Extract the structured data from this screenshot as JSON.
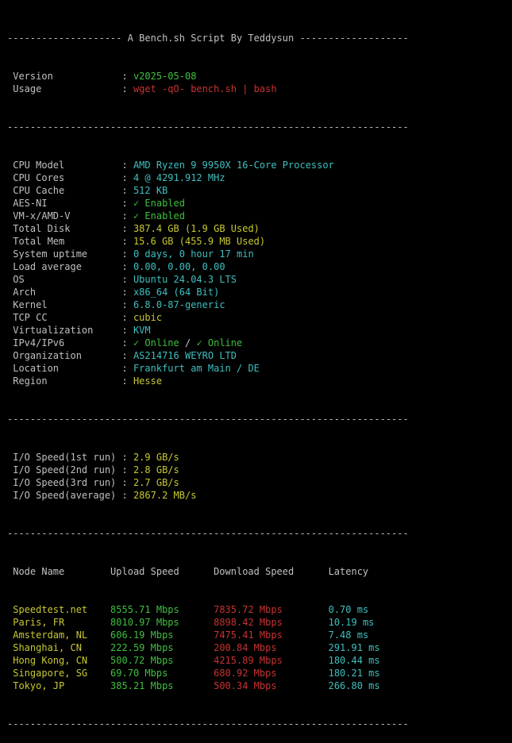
{
  "colors": {
    "background": "#000000",
    "text": "#c0c0c0",
    "green": "#3fbf3f",
    "red": "#c83232",
    "yellow": "#c8c832",
    "cyan": "#3fbfbf"
  },
  "header": "-------------------- A Bench.sh Script By Teddysun -------------------",
  "header_rows": [
    {
      "key": " Version            : ",
      "value": "v2025-05-08",
      "color": "green"
    },
    {
      "key": " Usage              : ",
      "value": "wget -qO- bench.sh | bash",
      "color": "red"
    }
  ],
  "separator": "----------------------------------------------------------------------",
  "system_rows": [
    {
      "key": " CPU Model          : ",
      "parts": [
        {
          "text": "AMD Ryzen 9 9950X 16-Core Processor",
          "color": "cyan"
        }
      ]
    },
    {
      "key": " CPU Cores          : ",
      "parts": [
        {
          "text": "4 @ 4291.912 MHz",
          "color": "cyan"
        }
      ]
    },
    {
      "key": " CPU Cache          : ",
      "parts": [
        {
          "text": "512 KB",
          "color": "cyan"
        }
      ]
    },
    {
      "key": " AES-NI             : ",
      "parts": [
        {
          "text": "✓ Enabled",
          "color": "green"
        }
      ]
    },
    {
      "key": " VM-x/AMD-V         : ",
      "parts": [
        {
          "text": "✓ Enabled",
          "color": "green"
        }
      ]
    },
    {
      "key": " Total Disk         : ",
      "parts": [
        {
          "text": "387.4 GB (1.9 GB Used)",
          "color": "yellow"
        }
      ]
    },
    {
      "key": " Total Mem          : ",
      "parts": [
        {
          "text": "15.6 GB (455.9 MB Used)",
          "color": "yellow"
        }
      ]
    },
    {
      "key": " System uptime      : ",
      "parts": [
        {
          "text": "0 days, 0 hour 17 min",
          "color": "cyan"
        }
      ]
    },
    {
      "key": " Load average       : ",
      "parts": [
        {
          "text": "0.00, 0.00, 0.00",
          "color": "cyan"
        }
      ]
    },
    {
      "key": " OS                 : ",
      "parts": [
        {
          "text": "Ubuntu 24.04.3 LTS",
          "color": "cyan"
        }
      ]
    },
    {
      "key": " Arch               : ",
      "parts": [
        {
          "text": "x86_64 (64 Bit)",
          "color": "cyan"
        }
      ]
    },
    {
      "key": " Kernel             : ",
      "parts": [
        {
          "text": "6.8.0-87-generic",
          "color": "cyan"
        }
      ]
    },
    {
      "key": " TCP CC             : ",
      "parts": [
        {
          "text": "cubic",
          "color": "yellow"
        }
      ]
    },
    {
      "key": " Virtualization     : ",
      "parts": [
        {
          "text": "KVM",
          "color": "cyan"
        }
      ]
    },
    {
      "key": " IPv4/IPv6          : ",
      "parts": [
        {
          "text": "✓ Online",
          "color": "green"
        },
        {
          "text": " / ",
          "color": "white"
        },
        {
          "text": "✓ Online",
          "color": "green"
        }
      ]
    },
    {
      "key": " Organization       : ",
      "parts": [
        {
          "text": "AS214716 WEYRO LTD",
          "color": "cyan"
        }
      ]
    },
    {
      "key": " Location           : ",
      "parts": [
        {
          "text": "Frankfurt am Main / DE",
          "color": "cyan"
        }
      ]
    },
    {
      "key": " Region             : ",
      "parts": [
        {
          "text": "Hesse",
          "color": "yellow"
        }
      ]
    }
  ],
  "io_rows": [
    {
      "key": " I/O Speed(1st run) : ",
      "value": "2.9 GB/s"
    },
    {
      "key": " I/O Speed(2nd run) : ",
      "value": "2.8 GB/s"
    },
    {
      "key": " I/O Speed(3rd run) : ",
      "value": "2.7 GB/s"
    },
    {
      "key": " I/O Speed(average) : ",
      "value": "2867.2 MB/s"
    }
  ],
  "speed_header": " Node Name        Upload Speed      Download Speed      Latency     ",
  "speed_rows": [
    {
      "node": " Speedtest.net    ",
      "upload": "8555.71 Mbps      ",
      "download": "7835.72 Mbps        ",
      "latency": "0.70 ms"
    },
    {
      "node": " Paris, FR        ",
      "upload": "8010.97 Mbps      ",
      "download": "8898.42 Mbps        ",
      "latency": "10.19 ms"
    },
    {
      "node": " Amsterdam, NL    ",
      "upload": "606.19 Mbps       ",
      "download": "7475.41 Mbps        ",
      "latency": "7.48 ms"
    },
    {
      "node": " Shanghai, CN     ",
      "upload": "222.59 Mbps       ",
      "download": "200.84 Mbps         ",
      "latency": "291.91 ms"
    },
    {
      "node": " Hong Kong, CN    ",
      "upload": "500.72 Mbps       ",
      "download": "4215.89 Mbps        ",
      "latency": "180.44 ms"
    },
    {
      "node": " Singapore, SG    ",
      "upload": "69.70 Mbps        ",
      "download": "680.92 Mbps         ",
      "latency": "180.21 ms"
    },
    {
      "node": " Tokyo, JP        ",
      "upload": "385.21 Mbps       ",
      "download": "500.34 Mbps         ",
      "latency": "266.80 ms"
    }
  ]
}
